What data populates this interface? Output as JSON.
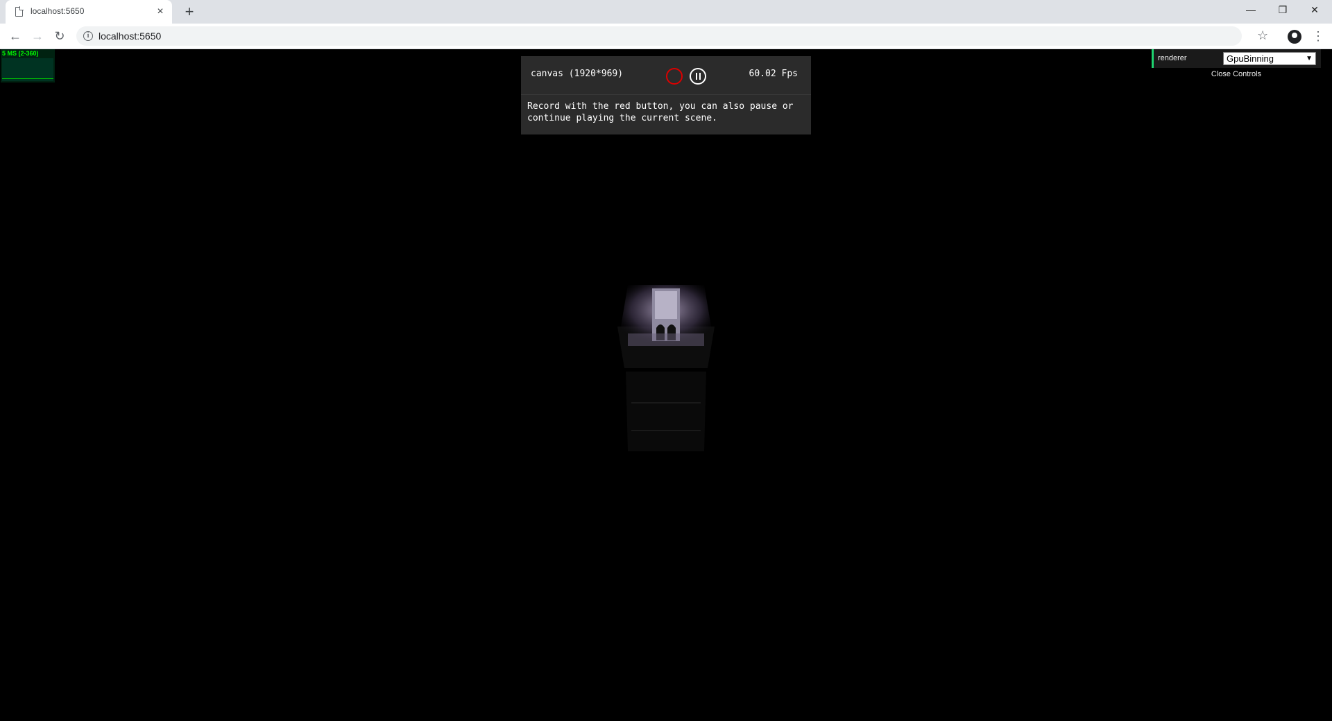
{
  "browser": {
    "tab_title": "localhost:5650",
    "tab_close": "×",
    "new_tab": "+",
    "url": "localhost:5650",
    "window_minimize": "—",
    "window_restore": "❐",
    "window_close": "✕",
    "back": "←",
    "forward": "→",
    "reload": "↻",
    "star": "☆",
    "menu": "⋮",
    "info": "i"
  },
  "stats": {
    "label": "5 MS (2-360)",
    "color": "#00ff00"
  },
  "recorder": {
    "canvas_size": "canvas (1920*969)",
    "fps": "60.02 Fps",
    "message": "Record with the red button, you can also pause or continue playing the current scene.",
    "record_color": "#dd0000"
  },
  "controls": {
    "label": "renderer",
    "selected": "GpuBinning",
    "caret": "▼",
    "close_label": "Close Controls",
    "accent": "#1ed36f"
  }
}
